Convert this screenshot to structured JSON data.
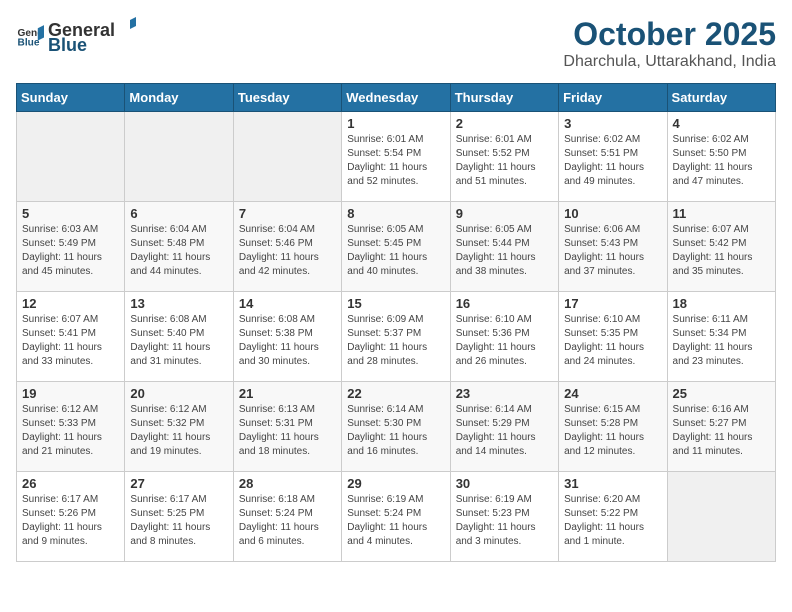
{
  "header": {
    "logo_general": "General",
    "logo_blue": "Blue",
    "title": "October 2025",
    "subtitle": "Dharchula, Uttarakhand, India"
  },
  "weekdays": [
    "Sunday",
    "Monday",
    "Tuesday",
    "Wednesday",
    "Thursday",
    "Friday",
    "Saturday"
  ],
  "weeks": [
    [
      {
        "day": "",
        "info": ""
      },
      {
        "day": "",
        "info": ""
      },
      {
        "day": "",
        "info": ""
      },
      {
        "day": "1",
        "info": "Sunrise: 6:01 AM\nSunset: 5:54 PM\nDaylight: 11 hours and 52 minutes."
      },
      {
        "day": "2",
        "info": "Sunrise: 6:01 AM\nSunset: 5:52 PM\nDaylight: 11 hours and 51 minutes."
      },
      {
        "day": "3",
        "info": "Sunrise: 6:02 AM\nSunset: 5:51 PM\nDaylight: 11 hours and 49 minutes."
      },
      {
        "day": "4",
        "info": "Sunrise: 6:02 AM\nSunset: 5:50 PM\nDaylight: 11 hours and 47 minutes."
      }
    ],
    [
      {
        "day": "5",
        "info": "Sunrise: 6:03 AM\nSunset: 5:49 PM\nDaylight: 11 hours and 45 minutes."
      },
      {
        "day": "6",
        "info": "Sunrise: 6:04 AM\nSunset: 5:48 PM\nDaylight: 11 hours and 44 minutes."
      },
      {
        "day": "7",
        "info": "Sunrise: 6:04 AM\nSunset: 5:46 PM\nDaylight: 11 hours and 42 minutes."
      },
      {
        "day": "8",
        "info": "Sunrise: 6:05 AM\nSunset: 5:45 PM\nDaylight: 11 hours and 40 minutes."
      },
      {
        "day": "9",
        "info": "Sunrise: 6:05 AM\nSunset: 5:44 PM\nDaylight: 11 hours and 38 minutes."
      },
      {
        "day": "10",
        "info": "Sunrise: 6:06 AM\nSunset: 5:43 PM\nDaylight: 11 hours and 37 minutes."
      },
      {
        "day": "11",
        "info": "Sunrise: 6:07 AM\nSunset: 5:42 PM\nDaylight: 11 hours and 35 minutes."
      }
    ],
    [
      {
        "day": "12",
        "info": "Sunrise: 6:07 AM\nSunset: 5:41 PM\nDaylight: 11 hours and 33 minutes."
      },
      {
        "day": "13",
        "info": "Sunrise: 6:08 AM\nSunset: 5:40 PM\nDaylight: 11 hours and 31 minutes."
      },
      {
        "day": "14",
        "info": "Sunrise: 6:08 AM\nSunset: 5:38 PM\nDaylight: 11 hours and 30 minutes."
      },
      {
        "day": "15",
        "info": "Sunrise: 6:09 AM\nSunset: 5:37 PM\nDaylight: 11 hours and 28 minutes."
      },
      {
        "day": "16",
        "info": "Sunrise: 6:10 AM\nSunset: 5:36 PM\nDaylight: 11 hours and 26 minutes."
      },
      {
        "day": "17",
        "info": "Sunrise: 6:10 AM\nSunset: 5:35 PM\nDaylight: 11 hours and 24 minutes."
      },
      {
        "day": "18",
        "info": "Sunrise: 6:11 AM\nSunset: 5:34 PM\nDaylight: 11 hours and 23 minutes."
      }
    ],
    [
      {
        "day": "19",
        "info": "Sunrise: 6:12 AM\nSunset: 5:33 PM\nDaylight: 11 hours and 21 minutes."
      },
      {
        "day": "20",
        "info": "Sunrise: 6:12 AM\nSunset: 5:32 PM\nDaylight: 11 hours and 19 minutes."
      },
      {
        "day": "21",
        "info": "Sunrise: 6:13 AM\nSunset: 5:31 PM\nDaylight: 11 hours and 18 minutes."
      },
      {
        "day": "22",
        "info": "Sunrise: 6:14 AM\nSunset: 5:30 PM\nDaylight: 11 hours and 16 minutes."
      },
      {
        "day": "23",
        "info": "Sunrise: 6:14 AM\nSunset: 5:29 PM\nDaylight: 11 hours and 14 minutes."
      },
      {
        "day": "24",
        "info": "Sunrise: 6:15 AM\nSunset: 5:28 PM\nDaylight: 11 hours and 12 minutes."
      },
      {
        "day": "25",
        "info": "Sunrise: 6:16 AM\nSunset: 5:27 PM\nDaylight: 11 hours and 11 minutes."
      }
    ],
    [
      {
        "day": "26",
        "info": "Sunrise: 6:17 AM\nSunset: 5:26 PM\nDaylight: 11 hours and 9 minutes."
      },
      {
        "day": "27",
        "info": "Sunrise: 6:17 AM\nSunset: 5:25 PM\nDaylight: 11 hours and 8 minutes."
      },
      {
        "day": "28",
        "info": "Sunrise: 6:18 AM\nSunset: 5:24 PM\nDaylight: 11 hours and 6 minutes."
      },
      {
        "day": "29",
        "info": "Sunrise: 6:19 AM\nSunset: 5:24 PM\nDaylight: 11 hours and 4 minutes."
      },
      {
        "day": "30",
        "info": "Sunrise: 6:19 AM\nSunset: 5:23 PM\nDaylight: 11 hours and 3 minutes."
      },
      {
        "day": "31",
        "info": "Sunrise: 6:20 AM\nSunset: 5:22 PM\nDaylight: 11 hours and 1 minute."
      },
      {
        "day": "",
        "info": ""
      }
    ]
  ]
}
